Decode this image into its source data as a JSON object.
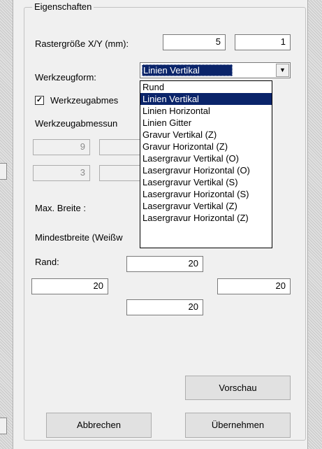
{
  "group": {
    "title": "Eigenschaften"
  },
  "raster": {
    "label": "Rastergröße X/Y (mm):",
    "x": "5",
    "y": "1"
  },
  "tool": {
    "label": "Werkzeugform:",
    "selected": "Linien Vertikal",
    "options": [
      "Rund",
      "Linien Vertikal",
      "Linien Horizontal",
      "Linien Gitter",
      "Gravur Vertikal (Z)",
      "Gravur Horizontal (Z)",
      "Lasergravur Vertikal (O)",
      "Lasergravur Horizontal (O)",
      "Lasergravur Vertikal (S)",
      "Lasergravur Horizontal (S)",
      "Lasergravur Vertikal (Z)",
      "Lasergravur Horizontal (Z)"
    ]
  },
  "toolsize": {
    "checkbox_label": "Werkzeugabmes",
    "label": "Werkzeugabmessun",
    "value1": "9",
    "value2": "3"
  },
  "max_width": {
    "label": "Max. Breite :"
  },
  "min_width": {
    "label": "Mindestbreite (Weißw"
  },
  "margin": {
    "label": "Rand:",
    "top": "20",
    "left": "20",
    "right": "20",
    "bottom": "20"
  },
  "buttons": {
    "preview": "Vorschau",
    "cancel": "Abbrechen",
    "apply": "Übernehmen"
  },
  "icons": {
    "checkbox_checked": "checkmark-icon",
    "dropdown_arrow": "chevron-down-icon"
  }
}
